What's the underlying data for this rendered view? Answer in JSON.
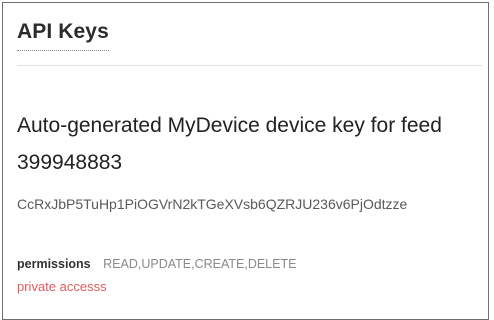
{
  "header": {
    "title": "API Keys"
  },
  "key": {
    "name": "Auto-generated MyDevice device key for feed 399948883",
    "value": "CcRxJbP5TuHp1PiOGVrN2kTGeXVsb6QZRJU236v6PjOdtzze",
    "permissions_label": "permissions",
    "permissions_value": "READ,UPDATE,CREATE,DELETE",
    "access": "private accesss"
  },
  "colors": {
    "border": "#6f6f6f",
    "title": "#2b2b2b",
    "key_value": "#5a5a5a",
    "permissions": "#8a8a8a",
    "private_access": "#e15b5b"
  }
}
